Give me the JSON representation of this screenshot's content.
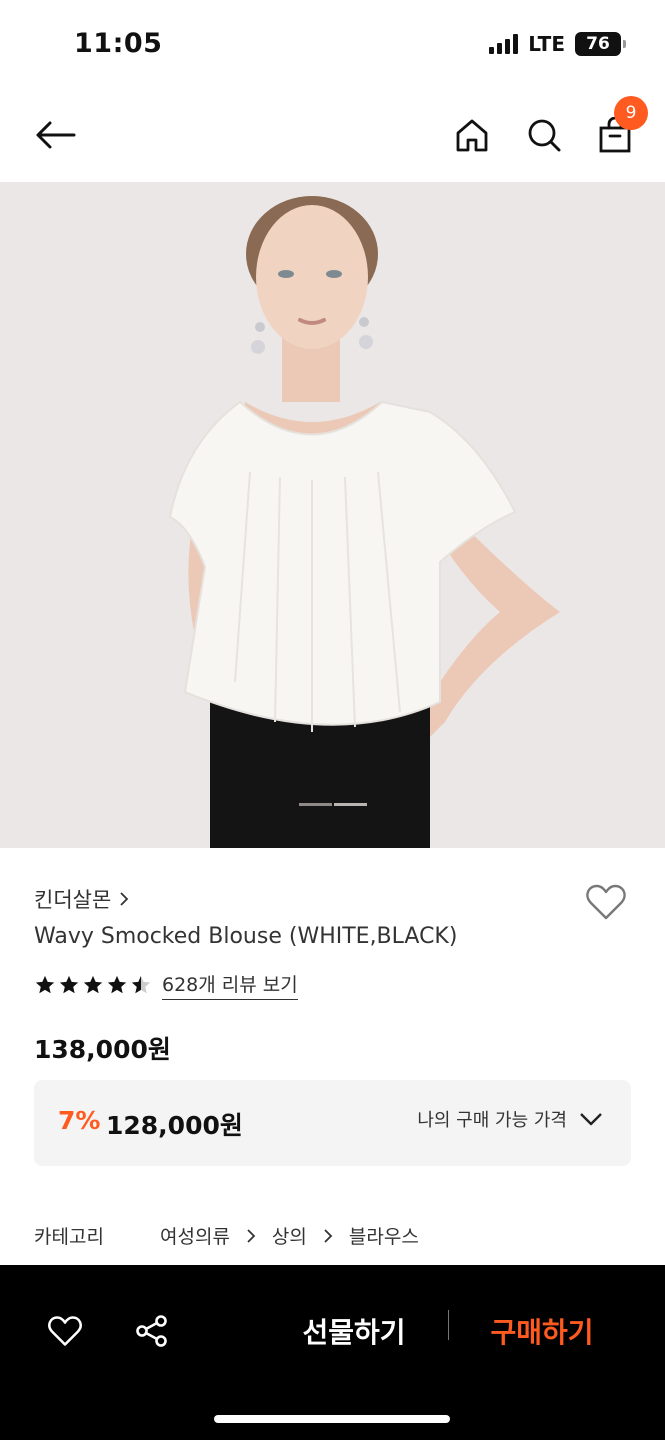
{
  "status_bar": {
    "time": "11:05",
    "network": "LTE",
    "battery": "76"
  },
  "header": {
    "cart_count": "9"
  },
  "product": {
    "brand": "킨더살몬",
    "name": "Wavy Smocked Blouse (WHITE,BLACK)",
    "rating": 4.5,
    "review_link": "628개 리뷰 보기",
    "original_price": "138,000원",
    "discount_rate": "7%",
    "sale_price": "128,000원",
    "my_price_label": "나의 구매 가능 가격",
    "image_page": 1,
    "image_page_count": 2
  },
  "category": {
    "label": "카테고리",
    "path": [
      "여성의류",
      "상의",
      "블라우스"
    ]
  },
  "bottom_bar": {
    "gift_label": "선물하기",
    "buy_label": "구매하기"
  },
  "colors": {
    "accent": "#ff5a1f",
    "image_bg": "#ebe7e6",
    "price_box_bg": "#f4f4f4"
  }
}
